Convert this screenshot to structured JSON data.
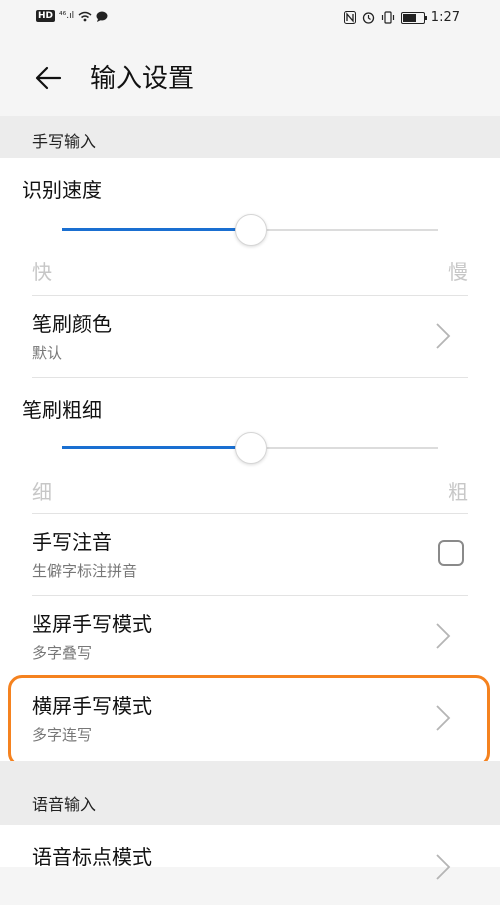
{
  "status_bar": {
    "badge": "HD",
    "signal": "⁴⁶.ıl",
    "time": "1:27"
  },
  "header": {
    "title": "输入设置",
    "back_icon": "arrow-left-icon"
  },
  "sections": {
    "handwriting": "手写输入",
    "voice": "语音输入"
  },
  "recognition_speed": {
    "label": "识别速度",
    "min_label": "快",
    "max_label": "慢",
    "value_fraction": 0.5
  },
  "brush_color": {
    "title": "笔刷颜色",
    "value": "默认"
  },
  "brush_thickness": {
    "label": "笔刷粗细",
    "min_label": "细",
    "max_label": "粗",
    "value_fraction": 0.5
  },
  "handwriting_phonetic": {
    "title": "手写注音",
    "subtitle": "生僻字标注拼音",
    "checked": false
  },
  "portrait_mode": {
    "title": "竖屏手写模式",
    "value": "多字叠写"
  },
  "landscape_mode": {
    "title": "横屏手写模式",
    "value": "多字连写"
  },
  "voice_punctuation": {
    "title": "语音标点模式"
  },
  "colors": {
    "accent": "#1a6fd1",
    "highlight": "#f5821f"
  }
}
